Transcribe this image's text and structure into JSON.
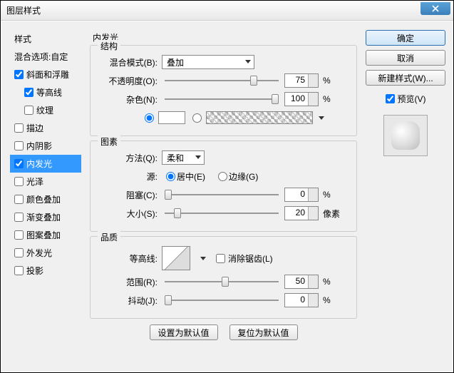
{
  "window": {
    "title": "图层样式"
  },
  "sidebar": {
    "header": "样式",
    "blendOptions": "混合选项:自定",
    "items": [
      {
        "label": "斜面和浮雕",
        "checked": true,
        "sub": false
      },
      {
        "label": "等高线",
        "checked": true,
        "sub": true
      },
      {
        "label": "纹理",
        "checked": false,
        "sub": true
      },
      {
        "label": "描边",
        "checked": false,
        "sub": false
      },
      {
        "label": "内阴影",
        "checked": false,
        "sub": false
      },
      {
        "label": "内发光",
        "checked": true,
        "sub": false,
        "highlight": true
      },
      {
        "label": "光泽",
        "checked": false,
        "sub": false
      },
      {
        "label": "颜色叠加",
        "checked": false,
        "sub": false
      },
      {
        "label": "渐变叠加",
        "checked": false,
        "sub": false
      },
      {
        "label": "图案叠加",
        "checked": false,
        "sub": false
      },
      {
        "label": "外发光",
        "checked": false,
        "sub": false
      },
      {
        "label": "投影",
        "checked": false,
        "sub": false
      }
    ]
  },
  "panel": {
    "title": "内发光",
    "structure": {
      "legend": "结构",
      "blendModeLabel": "混合模式(B):",
      "blendModeValue": "叠加",
      "opacityLabel": "不透明度(O):",
      "opacityValue": "75",
      "opacityUnit": "%",
      "noiseLabel": "杂色(N):",
      "noiseValue": "100",
      "noiseUnit": "%",
      "colorRadioSelected": true
    },
    "elements": {
      "legend": "图素",
      "techniqueLabel": "方法(Q):",
      "techniqueValue": "柔和",
      "sourceLabel": "源:",
      "sourceCenter": "居中(E)",
      "sourceEdge": "边缘(G)",
      "sourceSelected": "center",
      "chokeLabel": "阻塞(C):",
      "chokeValue": "0",
      "chokeUnit": "%",
      "sizeLabel": "大小(S):",
      "sizeValue": "20",
      "sizeUnit": "像素"
    },
    "quality": {
      "legend": "品质",
      "contourLabel": "等高线:",
      "antialiasLabel": "消除锯齿(L)",
      "antialiasChecked": false,
      "rangeLabel": "范围(R):",
      "rangeValue": "50",
      "rangeUnit": "%",
      "jitterLabel": "抖动(J):",
      "jitterValue": "0",
      "jitterUnit": "%"
    },
    "buttons": {
      "makeDefault": "设置为默认值",
      "resetDefault": "复位为默认值"
    }
  },
  "actions": {
    "ok": "确定",
    "cancel": "取消",
    "newStyle": "新建样式(W)...",
    "previewLabel": "预览(V)",
    "previewChecked": true
  }
}
